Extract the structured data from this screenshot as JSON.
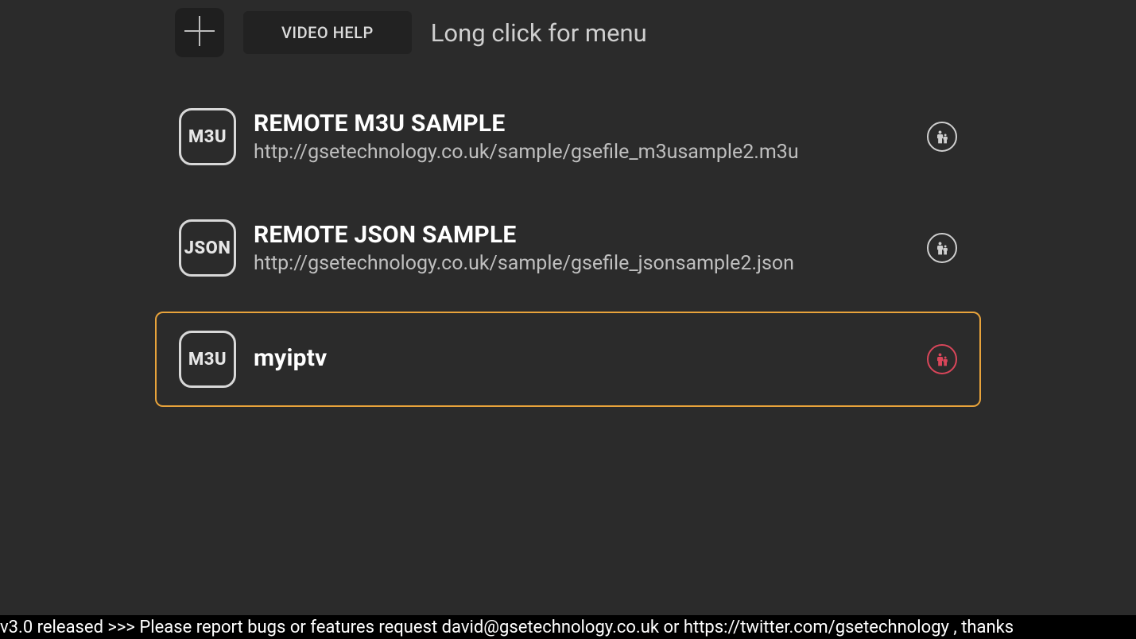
{
  "header": {
    "video_help_label": "VIDEO HELP",
    "hint_label": "Long click for menu"
  },
  "playlists": [
    {
      "type_label": "M3U",
      "title": "REMOTE M3U SAMPLE",
      "url": "http://gsetechnology.co.uk/sample/gsefile_m3usample2.m3u",
      "parental_active": false,
      "selected": false
    },
    {
      "type_label": "JSON",
      "title": "REMOTE JSON SAMPLE",
      "url": "http://gsetechnology.co.uk/sample/gsefile_jsonsample2.json",
      "parental_active": false,
      "selected": false
    },
    {
      "type_label": "M3U",
      "title": "myiptv",
      "url": "",
      "parental_active": true,
      "selected": true
    }
  ],
  "footer": {
    "ticker_text": "v3.0 released >>>  Please report bugs or features request david@gsetechnology.co.uk or https://twitter.com/gsetechnology , thanks"
  }
}
